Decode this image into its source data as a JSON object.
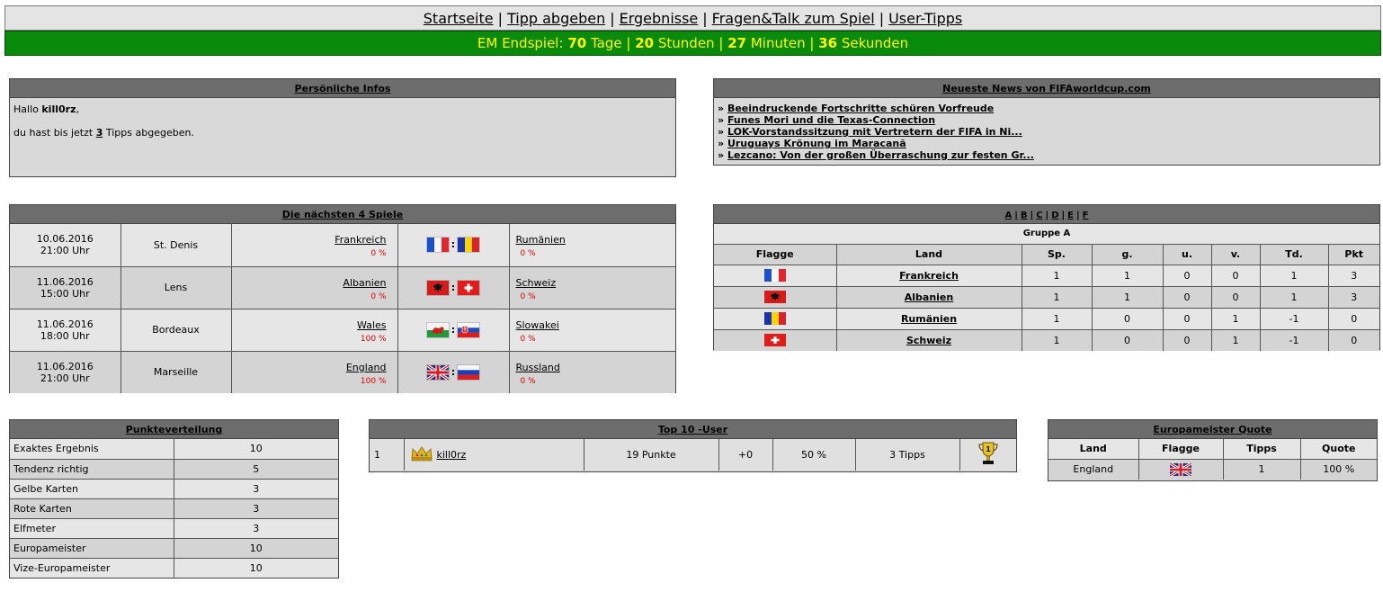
{
  "nav": {
    "items": [
      "Startseite",
      "Tipp abgeben",
      "Ergebnisse",
      "Fragen&Talk zum Spiel",
      "User-Tipps"
    ],
    "separator": "|"
  },
  "countdown": {
    "prefix": "EM Endspiel:",
    "days": "70",
    "days_label": "Tage",
    "hours": "20",
    "hours_label": "Stunden",
    "minutes": "27",
    "minutes_label": "Minuten",
    "seconds": "36",
    "seconds_label": "Sekunden",
    "sep": "|"
  },
  "personal": {
    "title": "Persönliche Infos",
    "greeting": "Hallo",
    "username": "kill0rz",
    "comma": ",",
    "line_prefix": "du hast bis jetzt",
    "tips_count": "3",
    "line_suffix": "Tipps abgegeben."
  },
  "news": {
    "title": "Neueste News von FIFAworldcup.com",
    "bullet": "»",
    "items": [
      "Beeindruckende Fortschritte schüren Vorfreude",
      "Funes Mori und die Texas-Connection",
      "LOK-Vorstandssitzung mit Vertretern der FIFA in Ni...",
      "Uruguays Krönung im Maracanã",
      "Lezcano: Von der großen Überraschung zur festen Gr..."
    ]
  },
  "games": {
    "title": "Die nächsten 4 Spiele",
    "colon": ":",
    "rows": [
      {
        "date": "10.06.2016",
        "time": "21:00 Uhr",
        "venue": "St. Denis",
        "home": "Frankreich",
        "home_pct": "0 %",
        "home_flag": "flag-france",
        "away_flag": "flag-romania",
        "away": "Rumänien",
        "away_pct": "0 %"
      },
      {
        "date": "11.06.2016",
        "time": "15:00 Uhr",
        "venue": "Lens",
        "home": "Albanien",
        "home_pct": "0 %",
        "home_flag": "flag-albania",
        "away_flag": "flag-switzerland",
        "away": "Schweiz",
        "away_pct": "0 %"
      },
      {
        "date": "11.06.2016",
        "time": "18:00 Uhr",
        "venue": "Bordeaux",
        "home": "Wales",
        "home_pct": "100 %",
        "home_flag": "flag-wales",
        "away_flag": "flag-slovakia",
        "away": "Slowakei",
        "away_pct": "0 %"
      },
      {
        "date": "11.06.2016",
        "time": "21:00 Uhr",
        "venue": "Marseille",
        "home": "England",
        "home_pct": "100 %",
        "home_flag": "flag-uk",
        "away_flag": "flag-russia",
        "away": "Russland",
        "away_pct": "0 %"
      }
    ]
  },
  "group": {
    "links": [
      "A",
      "B",
      "C",
      "D",
      "E",
      "F"
    ],
    "name": "Gruppe A",
    "headers": [
      "Flagge",
      "Land",
      "Sp.",
      "g.",
      "u.",
      "v.",
      "Td.",
      "Pkt"
    ],
    "rows": [
      {
        "flag": "flag-france",
        "country": "Frankreich",
        "sp": "1",
        "g": "1",
        "u": "0",
        "v": "0",
        "td": "1",
        "pkt": "3"
      },
      {
        "flag": "flag-albania",
        "country": "Albanien",
        "sp": "1",
        "g": "1",
        "u": "0",
        "v": "0",
        "td": "1",
        "pkt": "3"
      },
      {
        "flag": "flag-romania",
        "country": "Rumänien",
        "sp": "1",
        "g": "0",
        "u": "0",
        "v": "1",
        "td": "-1",
        "pkt": "0"
      },
      {
        "flag": "flag-switzerland",
        "country": "Schweiz",
        "sp": "1",
        "g": "0",
        "u": "0",
        "v": "1",
        "td": "-1",
        "pkt": "0"
      }
    ]
  },
  "points": {
    "title": "Punkteverteilung",
    "rows": [
      {
        "label": "Exaktes Ergebnis",
        "value": "10"
      },
      {
        "label": "Tendenz richtig",
        "value": "5"
      },
      {
        "label": "Gelbe Karten",
        "value": "3"
      },
      {
        "label": "Rote Karten",
        "value": "3"
      },
      {
        "label": "Elfmeter",
        "value": "3"
      },
      {
        "label": "Europameister",
        "value": "10"
      },
      {
        "label": "Vize-Europameister",
        "value": "10"
      }
    ]
  },
  "top10": {
    "title": "Top 10 -User",
    "rows": [
      {
        "rank": "1",
        "user": "kill0rz",
        "points": "19 Punkte",
        "diff": "+0",
        "pct": "50 %",
        "tips": "3 Tipps",
        "rank_icon": "crown-icon",
        "trophy_icon": "trophy-icon"
      }
    ]
  },
  "quote": {
    "title": "Europameister Quote",
    "headers": [
      "Land",
      "Flagge",
      "Tipps",
      "Quote"
    ],
    "rows": [
      {
        "country": "England",
        "flag": "flag-uk",
        "tips": "1",
        "quote": "100 %"
      }
    ]
  }
}
